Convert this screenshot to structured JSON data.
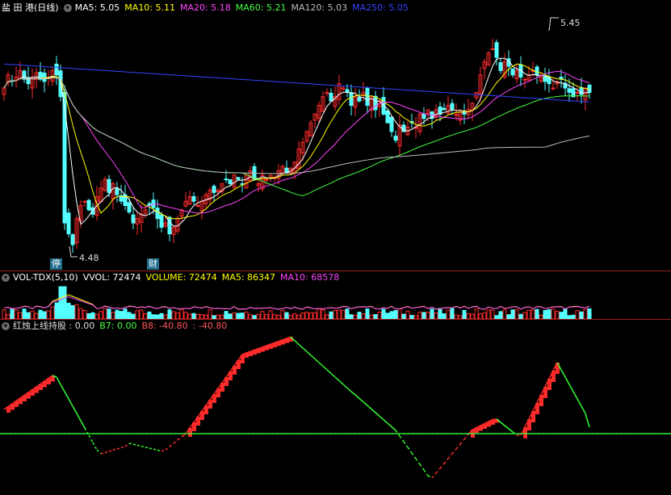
{
  "kline": {
    "title": "盐 田 港(日线)",
    "ma": [
      {
        "label": "MA5: 5.05",
        "color": "#ffffff"
      },
      {
        "label": "MA10: 5.11",
        "color": "#ffff00"
      },
      {
        "label": "MA20: 5.18",
        "color": "#ff44ff"
      },
      {
        "label": "MA60: 5.21",
        "color": "#44ff44"
      },
      {
        "label": "MA120: 5.03",
        "color": "#bbbbbb"
      },
      {
        "label": "MA250: 5.05",
        "color": "#3344ff"
      }
    ],
    "high_label": "5.45",
    "low_label": "4.48",
    "events": [
      "停",
      "财"
    ]
  },
  "volume": {
    "title": "VOL-TDX(5,10)",
    "values": [
      {
        "label": "VVOL: 72474",
        "color": "#ffffff"
      },
      {
        "label": "VOLUME: 72474",
        "color": "#ffff00"
      },
      {
        "label": "MA5: 86347",
        "color": "#ffff00"
      },
      {
        "label": "MA10: 68578",
        "color": "#ff44ff"
      }
    ]
  },
  "indicator": {
    "title": "红烛上线持股 : 0.00",
    "values": [
      {
        "label": "B7: 0.00",
        "color": "#44ff44"
      },
      {
        "label": "B8: -40.80",
        "color": "#ff5555"
      },
      {
        "label": ": -40.80",
        "color": "#ff5555"
      }
    ]
  },
  "colors": {
    "up": "#ff2a2a",
    "down": "#54ffff",
    "separator": "#9a1f1f",
    "zero_line": "#33ff33"
  },
  "chart_data": [
    {
      "type": "candlestick",
      "title": "盐 田 港(日线)",
      "x": [
        1,
        2,
        3,
        4,
        5,
        6,
        7,
        8,
        9,
        10,
        11,
        12,
        13,
        14,
        15,
        16,
        17,
        18,
        19,
        20,
        21,
        22,
        23,
        24,
        25,
        26,
        27,
        28,
        29,
        30,
        31,
        32,
        33,
        34,
        35,
        36,
        37,
        38,
        39,
        40,
        41,
        42,
        43,
        44,
        45,
        46,
        47,
        48,
        49,
        50,
        51,
        52,
        53,
        54,
        55,
        56,
        57,
        58,
        59,
        60,
        61,
        62,
        63,
        64,
        65,
        66,
        67,
        68,
        69,
        70,
        71,
        72,
        73,
        74,
        75,
        76,
        77,
        78,
        79,
        80,
        81,
        82,
        83,
        84,
        85,
        86,
        87,
        88,
        89,
        90,
        91,
        92,
        93,
        94,
        95,
        96,
        97,
        98,
        99,
        100,
        101,
        102,
        103,
        104,
        105,
        106,
        107,
        108,
        109,
        110,
        111,
        112,
        113,
        114,
        115,
        116,
        117,
        118,
        119,
        120,
        121,
        122,
        123,
        124,
        125,
        126,
        127,
        128,
        129,
        130,
        131,
        132,
        133,
        134,
        135,
        136,
        137,
        138,
        139,
        140,
        141,
        142,
        143,
        144,
        145,
        146,
        147,
        148,
        149,
        150,
        151,
        152,
        153,
        154,
        155,
        156,
        157,
        158,
        159,
        160,
        161,
        162,
        163,
        164,
        165,
        166
      ],
      "close": [
        5.22,
        5.28,
        5.25,
        5.27,
        5.3,
        5.26,
        5.24,
        5.27,
        5.29,
        5.26,
        5.25,
        5.27,
        5.3,
        5.28,
        5.18,
        4.62,
        4.55,
        4.5,
        4.62,
        4.68,
        4.7,
        4.66,
        4.64,
        4.72,
        4.76,
        4.8,
        4.74,
        4.78,
        4.73,
        4.7,
        4.68,
        4.65,
        4.6,
        4.62,
        4.64,
        4.66,
        4.68,
        4.67,
        4.62,
        4.58,
        4.6,
        4.55,
        4.58,
        4.62,
        4.66,
        4.7,
        4.72,
        4.7,
        4.68,
        4.7,
        4.73,
        4.75,
        4.74,
        4.75,
        4.78,
        4.8,
        4.78,
        4.82,
        4.8,
        4.78,
        4.82,
        4.84,
        4.8,
        4.78,
        4.82,
        4.8,
        4.82,
        4.81,
        4.84,
        4.86,
        4.83,
        4.85,
        4.88,
        4.94,
        4.97,
        5.02,
        5.06,
        5.1,
        5.14,
        5.18,
        5.2,
        5.16,
        5.18,
        5.24,
        5.22,
        5.2,
        5.14,
        5.18,
        5.16,
        5.2,
        5.14,
        5.18,
        5.12,
        5.16,
        5.1,
        5.06,
        5.02,
        4.98,
        5.05,
        5.02,
        5.04,
        5.06,
        5.04,
        5.1,
        5.08,
        5.12,
        5.08,
        5.12,
        5.1,
        5.12,
        5.14,
        5.12,
        5.1,
        5.11,
        5.1,
        5.12,
        5.15,
        5.2,
        5.28,
        5.34,
        5.38,
        5.4,
        5.36,
        5.3,
        5.34,
        5.32,
        5.28,
        5.3,
        5.27,
        5.26,
        5.28,
        5.3,
        5.28,
        5.27,
        5.25,
        5.24,
        5.22,
        5.25,
        5.26,
        5.22,
        5.2,
        5.18,
        5.2,
        5.19,
        5.22,
        5.2
      ],
      "high": 5.45,
      "low": 4.48,
      "moving_averages": [
        "MA5",
        "MA10",
        "MA20",
        "MA60",
        "MA120",
        "MA250"
      ]
    },
    {
      "type": "bar",
      "title": "VOL-TDX(5,10)",
      "values": [
        72474
      ]
    },
    {
      "type": "line",
      "title": "红烛上线持股",
      "values": [
        0.0,
        -40.8
      ]
    }
  ]
}
